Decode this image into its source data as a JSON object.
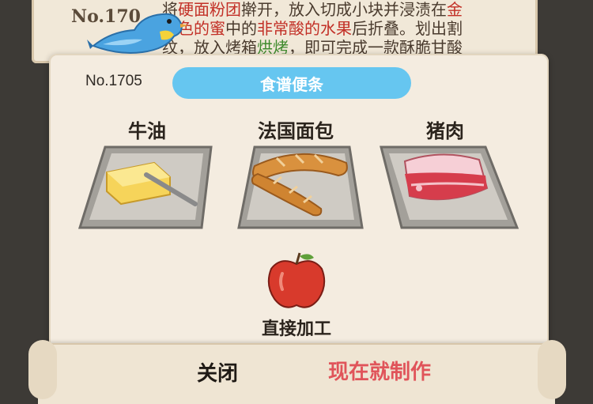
{
  "background_recipe": {
    "number": "No.170",
    "line1": [
      {
        "text": "将",
        "style": "normal"
      },
      {
        "text": "硬面粉团",
        "style": "red"
      },
      {
        "text": "擀开，放入切成小块并浸渍在",
        "style": "normal"
      },
      {
        "text": "金",
        "style": "red"
      }
    ],
    "line2": [
      {
        "text": "黄色的蜜",
        "style": "red"
      },
      {
        "text": "中的",
        "style": "normal"
      },
      {
        "text": "非常酸的水果",
        "style": "red"
      },
      {
        "text": "后折叠。划出割",
        "style": "normal"
      }
    ],
    "line3": [
      {
        "text": "纹，放入烤箱",
        "style": "normal"
      },
      {
        "text": "烘烤",
        "style": "green"
      },
      {
        "text": "，即可完成一款酥脆甘酸",
        "style": "normal"
      }
    ]
  },
  "popup": {
    "recipe_number": "No.1705",
    "title": "食谱便条",
    "ingredients": [
      {
        "label": "牛油",
        "icon": "butter-icon"
      },
      {
        "label": "法国面包",
        "icon": "baguette-icon"
      },
      {
        "label": "猪肉",
        "icon": "pork-icon"
      }
    ],
    "method_icon": "apple-icon",
    "method_label": "直接加工"
  },
  "buttons": {
    "close": "关闭",
    "make_now": "现在就制作"
  },
  "colors": {
    "accent_pill": "#66c6f0",
    "make_button": "#e0545a",
    "highlight_red": "#c22f26",
    "highlight_green": "#3e8a2c"
  }
}
